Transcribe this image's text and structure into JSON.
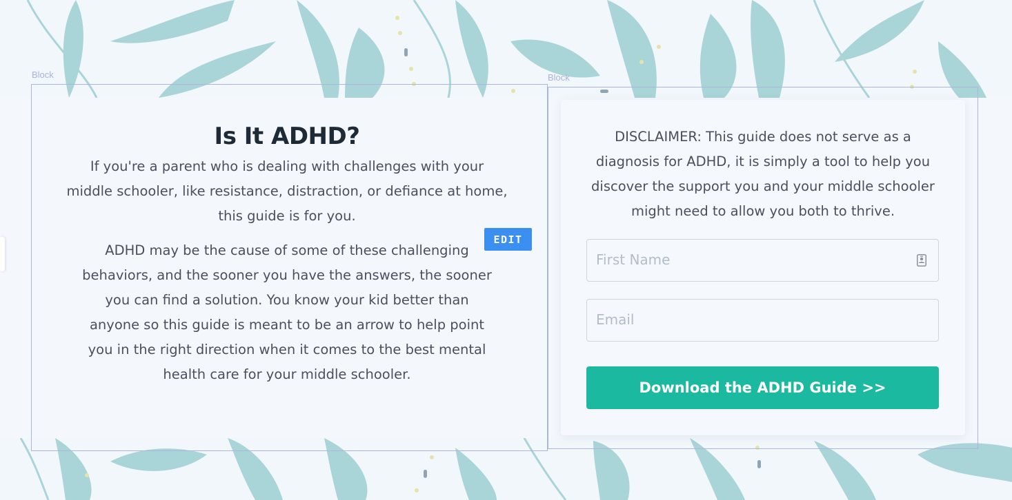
{
  "colors": {
    "background": "#f2f7fb",
    "leaf": "#a9d4d8",
    "accent_dots": "#e6e3a8",
    "cta_button": "#1bb99f",
    "edit_button": "#3b8ff0",
    "block_outline": "#aeb5dc"
  },
  "blocks": {
    "left_label": "Block",
    "right_label": "Block"
  },
  "intro": {
    "title": "Is It ADHD?",
    "paragraph_1": "If you're a parent who is dealing with challenges with your middle schooler, like resistance, distraction, or defiance at home, this guide is for you.",
    "paragraph_2": "ADHD may be the cause of some of these challenging behaviors, and the sooner you have the answers, the sooner you can find a solution. You know your kid better than anyone so this guide is meant to be an arrow to help point you in the right direction when it comes to the best mental health care for your middle schooler."
  },
  "editor": {
    "edit_label": "EDIT"
  },
  "form": {
    "disclaimer": "DISCLAIMER: This guide does not serve as a diagnosis for ADHD, it is simply a tool to help you discover the support you and your middle schooler might need to allow you both to thrive.",
    "first_name": {
      "placeholder": "First Name",
      "value": "",
      "icon": "contact-card-icon"
    },
    "email": {
      "placeholder": "Email",
      "value": ""
    },
    "submit_label": "Download the ADHD Guide >>"
  }
}
